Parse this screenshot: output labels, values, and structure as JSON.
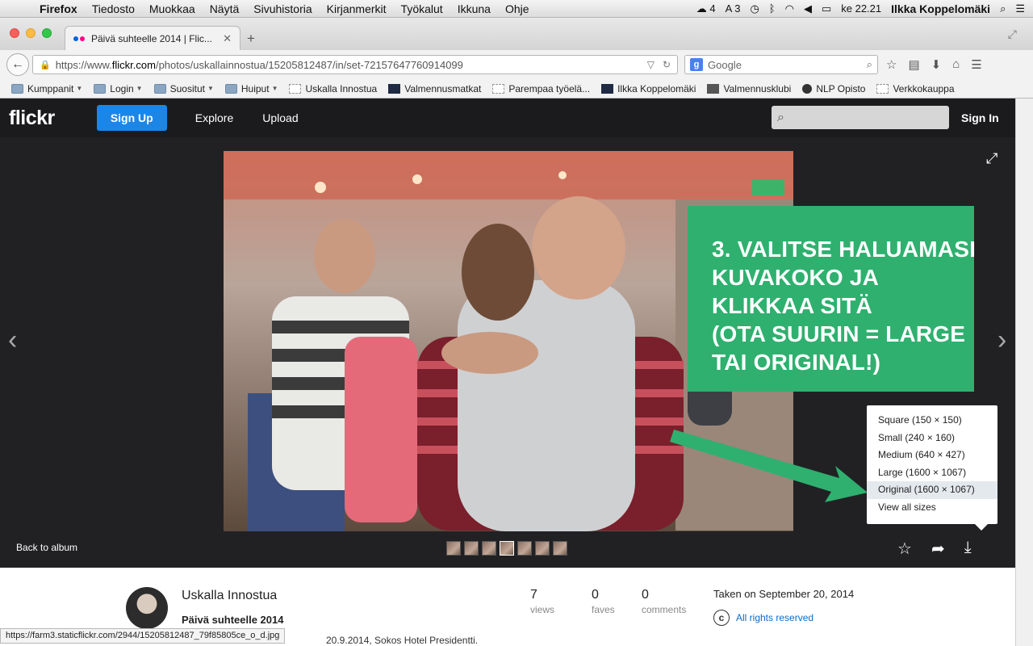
{
  "menubar": {
    "app": "Firefox",
    "items": [
      "Tiedosto",
      "Muokkaa",
      "Näytä",
      "Sivuhistoria",
      "Kirjanmerkit",
      "Työkalut",
      "Ikkuna",
      "Ohje"
    ],
    "status": {
      "cc_count": "4",
      "a3": "3",
      "clock": "ke 22.21",
      "user": "Ilkka Koppelomäki"
    }
  },
  "browser": {
    "tab_title": "Päivä suhteelle 2014 | Flic...",
    "url_prefix": "https://www.",
    "url_host": "flickr.com",
    "url_path": "/photos/uskallainnostua/15205812487/in/set-72157647760914099",
    "search_placeholder": "Google",
    "bookmarks": [
      {
        "label": "Kumppanit",
        "kind": "folder",
        "dropdown": true
      },
      {
        "label": "Login",
        "kind": "folder",
        "dropdown": true
      },
      {
        "label": "Suositut",
        "kind": "folder",
        "dropdown": true
      },
      {
        "label": "Huiput",
        "kind": "folder",
        "dropdown": true
      },
      {
        "label": "Uskalla Innostua",
        "kind": "page",
        "dropdown": false
      },
      {
        "label": "Valmennusmatkat",
        "kind": "sq",
        "dropdown": false
      },
      {
        "label": "Parempaa työelä...",
        "kind": "page",
        "dropdown": false
      },
      {
        "label": "Ilkka Koppelomäki",
        "kind": "sq",
        "dropdown": false
      },
      {
        "label": "Valmennusklubi",
        "kind": "cube",
        "dropdown": false
      },
      {
        "label": "NLP Opisto",
        "kind": "dot",
        "dropdown": false
      },
      {
        "label": "Verkkokauppa",
        "kind": "page",
        "dropdown": false
      }
    ],
    "status_url": "https://farm3.staticflickr.com/2944/15205812487_79f85805ce_o_d.jpg"
  },
  "flickr": {
    "logo": "flickr",
    "signup": "Sign Up",
    "explore": "Explore",
    "upload": "Upload",
    "signin": "Sign In",
    "back_to_album": "Back to album",
    "callout_lines": [
      "3. VALITSE HALUAMASI",
      "KUVAKOKO JA",
      "KLIKKAA SITÄ",
      "(OTA SUURIN = LARGE",
      "TAI ORIGINAL!)"
    ],
    "download_sizes": [
      {
        "label": "Square (150 × 150)",
        "highlighted": false
      },
      {
        "label": "Small (240 × 160)",
        "highlighted": false
      },
      {
        "label": "Medium (640 × 427)",
        "highlighted": false
      },
      {
        "label": "Large (1600 × 1067)",
        "highlighted": false
      },
      {
        "label": "Original (1600 × 1067)",
        "highlighted": true
      },
      {
        "label": "View all sizes",
        "highlighted": false
      }
    ],
    "owner": "Uskalla Innostua",
    "photo_title": "Päivä suhteelle 2014",
    "description": "20.9.2014, Sokos Hotel Presidentti.",
    "stats": [
      {
        "value": "7",
        "label": "views"
      },
      {
        "value": "0",
        "label": "faves"
      },
      {
        "value": "0",
        "label": "comments"
      }
    ],
    "taken": "Taken on September 20, 2014",
    "rights": "All rights reserved",
    "colors": {
      "signup": "#1c86e6",
      "callout": "#2fb06f",
      "nav_bg": "#1b1b1d",
      "page_bg": "#212124"
    }
  }
}
